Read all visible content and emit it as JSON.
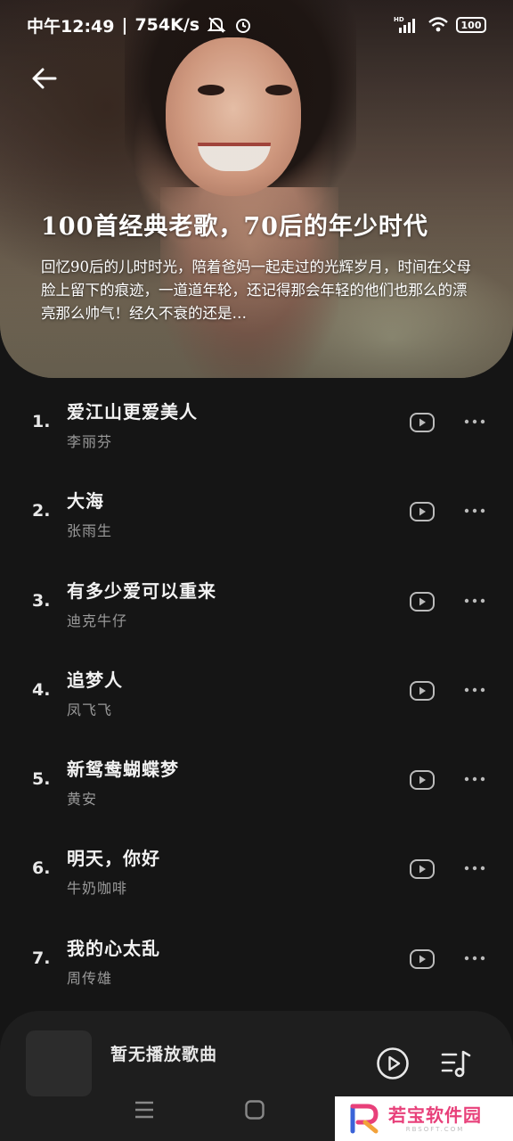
{
  "status_bar": {
    "time": "中午12:49",
    "speed": "754K/s",
    "battery": "100",
    "signal_label": "HD"
  },
  "header": {
    "back_icon": "arrow-left-icon",
    "title": "100首经典老歌，70后的年少时代",
    "description": "回忆90后的儿时时光，陪着爸妈一起走过的光辉岁月，时间在父母脸上留下的痕迹，一道道年轮，还记得那会年轻的他们也那么的漂亮那么帅气！经久不衰的还是…"
  },
  "songs": [
    {
      "index": "1.",
      "title": "爱江山更爱美人",
      "artist": "李丽芬"
    },
    {
      "index": "2.",
      "title": "大海",
      "artist": "张雨生"
    },
    {
      "index": "3.",
      "title": "有多少爱可以重来",
      "artist": "迪克牛仔"
    },
    {
      "index": "4.",
      "title": "追梦人",
      "artist": "凤飞飞"
    },
    {
      "index": "5.",
      "title": "新鸳鸯蝴蝶梦",
      "artist": "黄安"
    },
    {
      "index": "6.",
      "title": "明天，你好",
      "artist": "牛奶咖啡"
    },
    {
      "index": "7.",
      "title": "我的心太乱",
      "artist": "周传雄"
    }
  ],
  "mini_player": {
    "status_text": "暂无播放歌曲",
    "play_icon": "play-circle-icon",
    "queue_icon": "playlist-music-icon"
  },
  "watermark": {
    "text": "若宝软件园",
    "sub": "RBSOFT.COM"
  },
  "colors": {
    "background": "#151515",
    "mini_player": "#1e1e1e",
    "watermark_accent": "#e8407a"
  }
}
